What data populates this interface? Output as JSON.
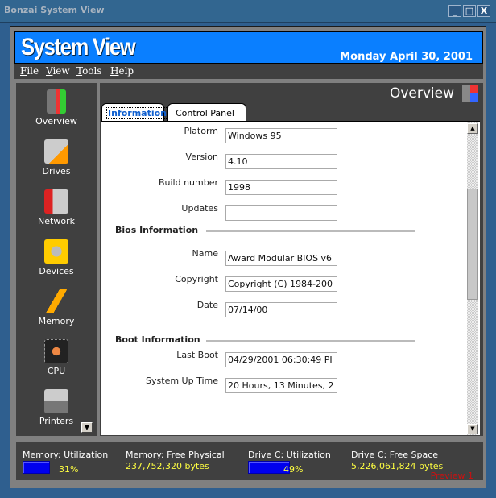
{
  "window": {
    "title": "Bonzai System View",
    "buttons": [
      "_",
      "□",
      "X"
    ]
  },
  "banner": {
    "title": "System View",
    "date": "Monday April 30, 2001"
  },
  "menu": [
    {
      "label": "File",
      "key": "F",
      "rest": "ile"
    },
    {
      "label": "View",
      "key": "V",
      "rest": "iew"
    },
    {
      "label": "Tools",
      "key": "T",
      "rest": "ools"
    },
    {
      "label": "Help",
      "key": "H",
      "rest": "elp"
    }
  ],
  "sidebar": {
    "items": [
      {
        "label": "Overview"
      },
      {
        "label": "Drives"
      },
      {
        "label": "Network"
      },
      {
        "label": "Devices"
      },
      {
        "label": "Memory"
      },
      {
        "label": "CPU"
      },
      {
        "label": "Printers"
      }
    ],
    "scroll_down": "▼"
  },
  "main": {
    "title": "Overview",
    "tabs": [
      "Information",
      "Control Panel"
    ],
    "active_tab": "Information"
  },
  "info": {
    "fields": [
      {
        "label": "Platorm",
        "value": "Windows 95"
      },
      {
        "label": "Version",
        "value": "4.10"
      },
      {
        "label": "Build number",
        "value": "1998"
      },
      {
        "label": "Updates",
        "value": ""
      }
    ],
    "bios_heading": "Bios Information",
    "bios": [
      {
        "label": "Name",
        "value": "Award Modular BIOS v6"
      },
      {
        "label": "Copyright",
        "value": "Copyright (C) 1984-200"
      },
      {
        "label": "Date",
        "value": "07/14/00"
      }
    ],
    "boot_heading": "Boot Information",
    "boot": [
      {
        "label": "Last Boot",
        "value": "04/29/2001 06:30:49 PI"
      },
      {
        "label": "System Up Time",
        "value": "20 Hours, 13 Minutes, 2"
      }
    ]
  },
  "scroll": {
    "up": "▲",
    "down": "▼"
  },
  "status": {
    "mem_util_label": "Memory: Utilization",
    "mem_util_pct": "31%",
    "mem_util_value": 31,
    "mem_free_label": "Memory: Free Physical",
    "mem_free_value": "237,752,320 bytes",
    "drive_util_label": "Drive C: Utilization",
    "drive_util_pct": "49%",
    "drive_util_value": 49,
    "drive_free_label": "Drive C: Free Space",
    "drive_free_value": "5,226,061,824 bytes",
    "preview": "Preview 1"
  },
  "colors": {
    "banner": "#0a7fff",
    "window": "#2f5f8f",
    "panel": "#404040",
    "value_text": "#ffff40",
    "bar": "#0000ee"
  }
}
